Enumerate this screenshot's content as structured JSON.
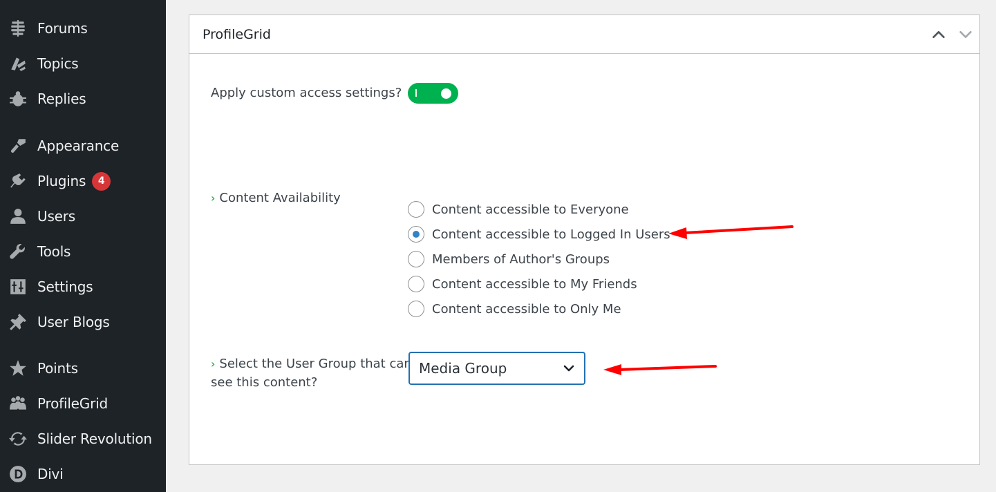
{
  "sidebar": {
    "items": [
      {
        "label": "Forums",
        "icon": "forums-icon"
      },
      {
        "label": "Topics",
        "icon": "topics-icon"
      },
      {
        "label": "Replies",
        "icon": "replies-icon"
      },
      {
        "label": "Appearance",
        "icon": "paintbrush-icon"
      },
      {
        "label": "Plugins",
        "icon": "plugins-icon",
        "badge": "4"
      },
      {
        "label": "Users",
        "icon": "users-icon"
      },
      {
        "label": "Tools",
        "icon": "wrench-icon"
      },
      {
        "label": "Settings",
        "icon": "settings-icon"
      },
      {
        "label": "User Blogs",
        "icon": "pushpin-icon"
      },
      {
        "label": "Points",
        "icon": "star-icon"
      },
      {
        "label": "ProfileGrid",
        "icon": "groups-icon"
      },
      {
        "label": "Slider Revolution",
        "icon": "refresh-icon"
      },
      {
        "label": "Divi",
        "icon": "divi-icon"
      }
    ]
  },
  "panel": {
    "title": "ProfileGrid",
    "custom_access_label": "Apply custom access settings?",
    "custom_access_enabled": true,
    "content_availability": {
      "label": "Content Availability",
      "options": [
        {
          "label": "Content accessible to Everyone",
          "checked": false
        },
        {
          "label": "Content accessible to Logged In Users",
          "checked": true
        },
        {
          "label": "Members of Author's Groups",
          "checked": false
        },
        {
          "label": "Content accessible to My Friends",
          "checked": false
        },
        {
          "label": "Content accessible to Only Me",
          "checked": false
        }
      ]
    },
    "user_group": {
      "label_line1": "Select the User Group that can",
      "label_line2": "see this content?",
      "selected": "Media Group"
    }
  },
  "colors": {
    "sidebar_bg": "#1d2327",
    "badge": "#d63638",
    "toggle_on": "#00b14f",
    "accent": "#2271b1",
    "annotation_arrow": "#ff0000"
  }
}
